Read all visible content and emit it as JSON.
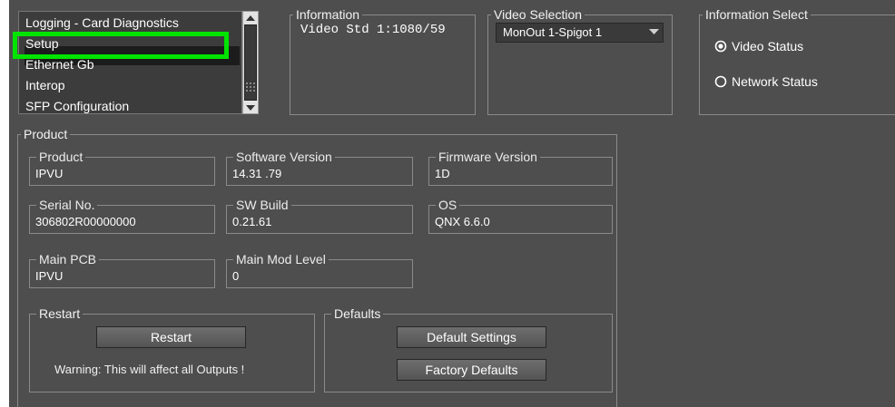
{
  "list": {
    "items": [
      "Logging - Card Diagnostics",
      "Setup",
      "Ethernet Gb",
      "Interop",
      "SFP Configuration"
    ],
    "selected_index": 1,
    "highlight_color": "#00e400"
  },
  "information": {
    "title": "Information",
    "text": "Video Std 1:1080/59"
  },
  "video_selection": {
    "title": "Video Selection",
    "selected": "MonOut 1-Spigot 1"
  },
  "info_select": {
    "title": "Information Select",
    "options": [
      {
        "label": "Video Status",
        "checked": true
      },
      {
        "label": "Network Status",
        "checked": false
      }
    ]
  },
  "product": {
    "title": "Product",
    "fields": {
      "product": {
        "label": "Product",
        "value": "IPVU"
      },
      "software_version": {
        "label": "Software Version",
        "value": "14.31 .79"
      },
      "firmware_version": {
        "label": "Firmware Version",
        "value": "1D"
      },
      "serial_no": {
        "label": "Serial No.",
        "value": "306802R00000000"
      },
      "sw_build": {
        "label": "SW Build",
        "value": "0.21.61"
      },
      "os": {
        "label": "OS",
        "value": "QNX 6.6.0"
      },
      "main_pcb": {
        "label": "Main PCB",
        "value": "IPVU"
      },
      "main_mod_level": {
        "label": "Main Mod Level",
        "value": "0"
      }
    }
  },
  "restart": {
    "title": "Restart",
    "button": "Restart",
    "warning": "Warning: This will affect all Outputs !"
  },
  "defaults": {
    "title": "Defaults",
    "default_settings": "Default Settings",
    "factory_defaults": "Factory Defaults"
  }
}
